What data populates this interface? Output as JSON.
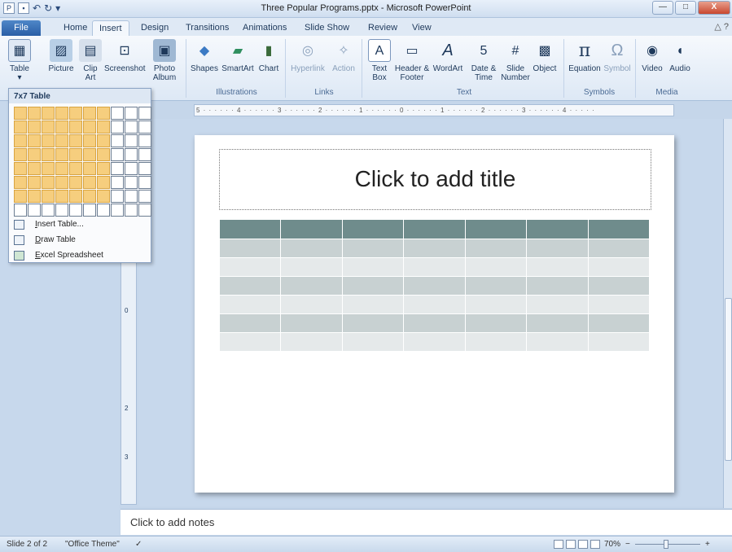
{
  "window": {
    "title": "Three Popular Programs.pptx - Microsoft PowerPoint",
    "controls": {
      "minimize": "—",
      "maximize": "□",
      "close": "X"
    }
  },
  "quick_access": {
    "app_icon": "P",
    "save_icon": "save-icon",
    "undo_icon": "↶",
    "redo_icon": "↻",
    "dropdown": "▾"
  },
  "tabs": [
    "File",
    "Home",
    "Insert",
    "Design",
    "Transitions",
    "Animations",
    "Slide Show",
    "Review",
    "View"
  ],
  "active_tab": "Insert",
  "tab_right": "△ ?",
  "ribbon": {
    "buttons": {
      "table": "Table",
      "table_arrow": "▾",
      "picture": "Picture",
      "clip_art": "Clip Art",
      "screenshot": "Screenshot",
      "photo_album": "Photo Album",
      "shapes": "Shapes",
      "smartart": "SmartArt",
      "chart": "Chart",
      "hyperlink": "Hyperlink",
      "action": "Action",
      "text_box": "Text Box",
      "header_footer": "Header & Footer",
      "wordart": "WordArt",
      "date_time": "Date & Time",
      "slide_number": "Slide Number",
      "object": "Object",
      "equation": "Equation",
      "symbol": "Symbol",
      "video": "Video",
      "audio": "Audio"
    },
    "groups": {
      "illustrations": "Illustrations",
      "links": "Links",
      "text": "Text",
      "symbols": "Symbols",
      "media": "Media"
    }
  },
  "table_menu": {
    "header": "7x7 Table",
    "grid_rows": 8,
    "grid_cols": 10,
    "selected_rows": 7,
    "selected_cols": 7,
    "items": [
      {
        "prefix": "I",
        "rest": "nsert Table..."
      },
      {
        "prefix": "D",
        "rest": "raw Table"
      },
      {
        "prefix": "E",
        "rest": "xcel Spreadsheet"
      }
    ]
  },
  "ruler": {
    "horizontal": "5 · · · · · · 4 · · · · · · 3 · · · · · · 2 · · · · · · 1 · · · · · · 0 · · · · · · 1 · · · · · · 2 · · · · · · 3 · · · · · · 4 · · · · ·",
    "vertical_marks": [
      "0",
      "2",
      "3"
    ]
  },
  "slide": {
    "title_placeholder": "Click to add title",
    "table_rows": 7,
    "table_cols": 7
  },
  "notes_placeholder": "Click to add notes",
  "status": {
    "slide": "Slide 2 of 2",
    "theme": "\"Office Theme\"",
    "zoom": "70%",
    "zoom_minus": "−",
    "zoom_plus": "+"
  },
  "colors": {
    "table_header": "#6f8c8c",
    "table_band": "#c8d1d2",
    "grid_highlight": "#f6ce7e",
    "file_tab": "#2a5ea6"
  }
}
